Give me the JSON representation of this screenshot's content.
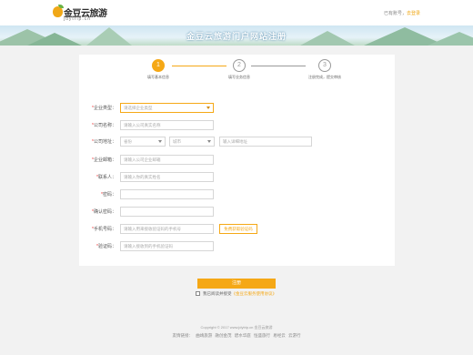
{
  "brand": {
    "name": "金豆云旅游",
    "domain": "jdytrip.cn",
    "accent_color": "#f5a816"
  },
  "account": {
    "prompt": "已有账号，",
    "login_link": "去登录"
  },
  "banner": {
    "title": "金豆云旅游门户网站注册"
  },
  "steps": [
    {
      "number": "1",
      "label": "填写基本信息",
      "state": "active"
    },
    {
      "number": "2",
      "label": "填写业务信息",
      "state": "todo"
    },
    {
      "number": "3",
      "label": "注册完成，提交审核",
      "state": "todo"
    }
  ],
  "form": {
    "company_type": {
      "label": "企业类型：",
      "required": true,
      "placeholder": "请选择企业类型"
    },
    "company_name": {
      "label": "公司名称：",
      "required": true,
      "placeholder": "请输入公司真实名称"
    },
    "company_address": {
      "label": "公司地址：",
      "required": true,
      "province_placeholder": "省份",
      "city_placeholder": "城市",
      "detail_placeholder": "输入详细地址"
    },
    "email": {
      "label": "企业邮箱：",
      "required": true,
      "placeholder": "请输入公司企业邮箱"
    },
    "contact": {
      "label": "联系人：",
      "required": true,
      "placeholder": "请输入你的真实姓名"
    },
    "password": {
      "label": "密码：",
      "required": true,
      "placeholder": ""
    },
    "confirm_password": {
      "label": "确认密码：",
      "required": true,
      "placeholder": ""
    },
    "phone": {
      "label": "手机号码：",
      "required": true,
      "placeholder": "请输入用来接收验证码的手机号",
      "code_button": "免费获取验证码"
    },
    "verify_code": {
      "label": "验证码：",
      "required": true,
      "placeholder": "请输入接收到的手机验证码"
    }
  },
  "submit_label": "注册",
  "agreement": {
    "text": "我已阅读并接受",
    "link": "《金豆云服务使用协议》"
  },
  "footer": {
    "copyright": "Copyright © 2017 www.jdytrip.cn 金豆云旅游",
    "links": [
      "友情链接：",
      "曲靖旅游",
      "融创金茂",
      "碧水华庭",
      "恒盛旅行",
      "易经云",
      "云游行"
    ]
  }
}
